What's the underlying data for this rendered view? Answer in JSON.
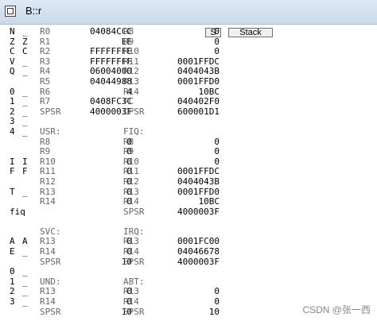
{
  "window": {
    "title": "B::r"
  },
  "buttons": {
    "s": "S",
    "stack": "Stack"
  },
  "rows": [
    {
      "flag": "N",
      "flag2": "_",
      "lab1": "R0",
      "val1": "04084CCC",
      "lab2": "R8",
      "val2": "0"
    },
    {
      "flag": "Z",
      "flag2": "Z",
      "lab1": "R1",
      "val1": "EE",
      "lab2": "R9",
      "val2": "0"
    },
    {
      "flag": "C",
      "flag2": "C",
      "lab1": "R2",
      "val1": "FFFFFFFE",
      "lab2": "R10",
      "val2": "0"
    },
    {
      "flag": "V",
      "flag2": "_",
      "lab1": "R3",
      "val1": "FFFFFFFF",
      "lab2": "R11",
      "val2": "0001FFDC"
    },
    {
      "flag": "Q",
      "flag2": "_",
      "lab1": "R4",
      "val1": "06004000",
      "lab2": "R12",
      "val2": "0404043B"
    },
    {
      "flag": "",
      "flag2": "",
      "lab1": "R5",
      "val1": "04044988",
      "lab2": "R13",
      "val2": "0001FFD0"
    },
    {
      "flag": "0",
      "flag2": "_",
      "lab1": "R6",
      "val1": "4",
      "lab2": "R14",
      "val2": "10BC"
    },
    {
      "flag": "1",
      "flag2": "_",
      "lab1": "R7",
      "val1": "0408FC3C",
      "lab2": "PC",
      "val2": "040402F0"
    },
    {
      "flag": "2",
      "flag2": "_",
      "lab1": "SPSR",
      "val1": "4000003F",
      "lab2": "CPSR",
      "val2": "600001D1"
    },
    {
      "flag": "3",
      "flag2": "_",
      "lab1": "",
      "val1": "",
      "lab2": "",
      "val2": ""
    },
    {
      "flag": "4",
      "flag2": "_",
      "lab1": "USR:",
      "val1": "",
      "lab2": "FIQ:",
      "val2": ""
    },
    {
      "flag": "",
      "flag2": "",
      "lab1": "R8",
      "val1": "0",
      "lab2": "R8",
      "val2": "0"
    },
    {
      "flag": "",
      "flag2": "",
      "lab1": "R9",
      "val1": "0",
      "lab2": "R9",
      "val2": "0"
    },
    {
      "flag": "I",
      "flag2": "I",
      "lab1": "R10",
      "val1": "0",
      "lab2": "R10",
      "val2": "0"
    },
    {
      "flag": "F",
      "flag2": "F",
      "lab1": "R11",
      "val1": "0",
      "lab2": "R11",
      "val2": "0001FFDC"
    },
    {
      "flag": "",
      "flag2": "",
      "lab1": "R12",
      "val1": "0",
      "lab2": "R12",
      "val2": "0404043B"
    },
    {
      "flag": "T",
      "flag2": "_",
      "lab1": "R13",
      "val1": "0",
      "lab2": "R13",
      "val2": "0001FFD0"
    },
    {
      "flag": "",
      "flag2": "",
      "lab1": "R14",
      "val1": "0",
      "lab2": "R14",
      "val2": "10BC"
    },
    {
      "flag": "fiq",
      "flag2": "",
      "lab1": "",
      "val1": "",
      "lab2": "SPSR",
      "val2": "4000003F"
    },
    {
      "flag": "",
      "flag2": "",
      "lab1": "",
      "val1": "",
      "lab2": "",
      "val2": ""
    },
    {
      "flag": "",
      "flag2": "",
      "lab1": "SVC:",
      "val1": "",
      "lab2": "IRQ:",
      "val2": ""
    },
    {
      "flag": "A",
      "flag2": "A",
      "lab1": "R13",
      "val1": "0",
      "lab2": "R13",
      "val2": "0001FC00"
    },
    {
      "flag": "E",
      "flag2": "_",
      "lab1": "R14",
      "val1": "0",
      "lab2": "R14",
      "val2": "04046678"
    },
    {
      "flag": "",
      "flag2": "",
      "lab1": "SPSR",
      "val1": "10",
      "lab2": "SPSR",
      "val2": "4000003F"
    },
    {
      "flag": "0",
      "flag2": "_",
      "lab1": "",
      "val1": "",
      "lab2": "",
      "val2": ""
    },
    {
      "flag": "1",
      "flag2": "_",
      "lab1": "UND:",
      "val1": "",
      "lab2": "ABT:",
      "val2": ""
    },
    {
      "flag": "2",
      "flag2": "_",
      "lab1": "R13",
      "val1": "0",
      "lab2": "R13",
      "val2": "0"
    },
    {
      "flag": "3",
      "flag2": "_",
      "lab1": "R14",
      "val1": "0",
      "lab2": "R14",
      "val2": "0"
    },
    {
      "flag": "",
      "flag2": "",
      "lab1": "SPSR",
      "val1": "10",
      "lab2": "SPSR",
      "val2": "10"
    }
  ],
  "watermark": "CSDN @张一西"
}
